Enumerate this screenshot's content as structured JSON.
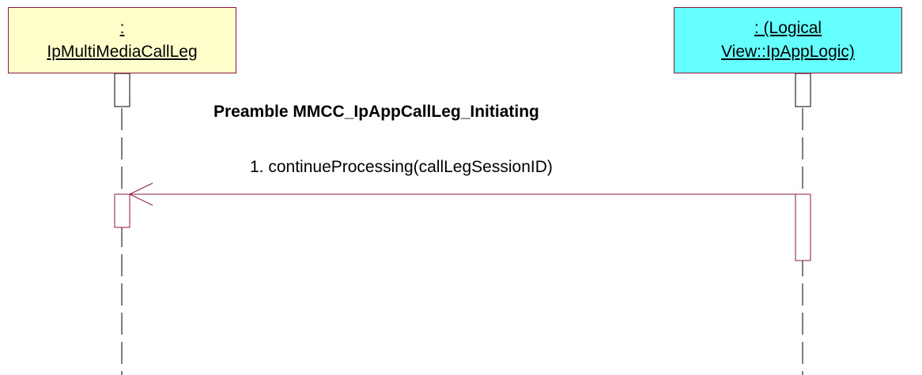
{
  "lifelines": [
    {
      "line1": ":",
      "line2": "IpMultiMediaCallLeg",
      "fill_color": "#ffffcc"
    },
    {
      "line1": ": (Logical",
      "line2": "View::IpAppLogic)",
      "fill_color": "#66ffff"
    }
  ],
  "frame_title": "Preamble MMCC_IpAppCallLeg_Initiating",
  "messages": [
    {
      "label": "1. continueProcessing(callLegSessionID)",
      "from": "View::IpAppLogic",
      "to": "IpMultiMediaCallLeg"
    }
  ],
  "colors": {
    "border": "#8b1a3a",
    "message_line": "#8b1a3a",
    "lifeline": "#000000"
  }
}
